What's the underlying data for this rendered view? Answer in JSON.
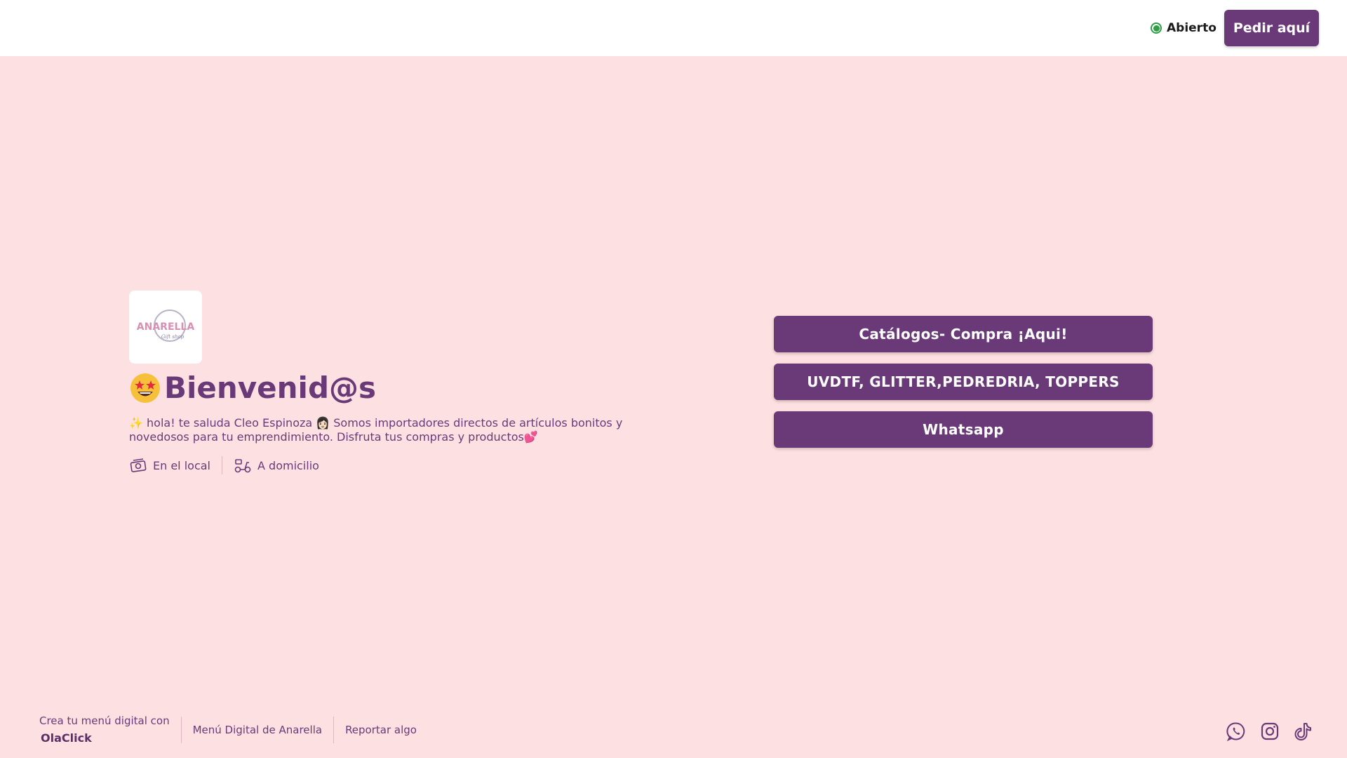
{
  "header": {
    "status_label": "Abierto",
    "order_button_label": "Pedir aquí",
    "status_color": "#2e9e46"
  },
  "profile": {
    "logo_alt": "Anarella gift shop logo",
    "logo_text": "ANARELLA",
    "logo_subtext": "Gift shop",
    "title": "Bienvenid@s",
    "description": "✨ hola! te saluda Cleo Espinoza 👩🏻 Somos importadores directos de artículos bonitos y novedosos para tu emprendimiento. Disfruta tus compras y productos💕",
    "services": [
      {
        "label": "En el local",
        "icon": "storefront-icon"
      },
      {
        "label": "A domicilio",
        "icon": "scooter-icon"
      }
    ]
  },
  "links": [
    {
      "label": "Catálogos- Compra ¡Aqui!"
    },
    {
      "label": "UVDTF, GLITTER,PEDREDRIA, TOPPERS"
    },
    {
      "label": "Whatsapp"
    }
  ],
  "footer": {
    "promo_text": "Crea tu menú digital con",
    "brand": "OlaClick",
    "menu_link": "Menú Digital de Anarella",
    "report_link": "Reportar algo"
  },
  "socials": [
    "whatsapp-icon",
    "instagram-icon",
    "tiktok-icon"
  ],
  "colors": {
    "accent": "#6a3a78",
    "background": "#fde0e1",
    "header_background": "#ffffff"
  }
}
